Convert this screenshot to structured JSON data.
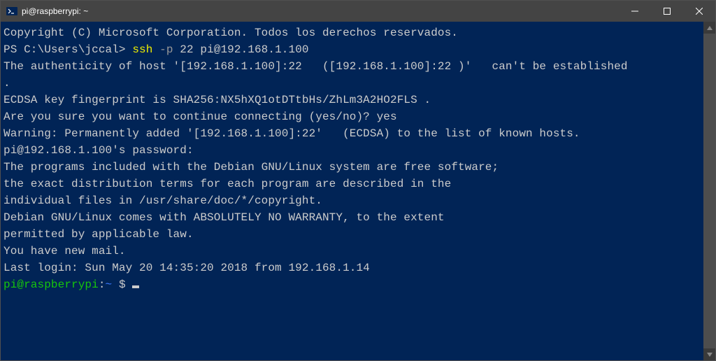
{
  "titlebar": {
    "title": "pi@raspberrypi: ~"
  },
  "terminal": {
    "copyright": "Copyright (C) Microsoft Corporation. Todos los derechos reservados.",
    "blank": "",
    "ps_prompt": "PS C:\\Users\\jccal> ",
    "ssh_cmd": "ssh ",
    "ssh_flag": "-p ",
    "ssh_args": "22 pi@192.168.1.100",
    "auth1": "The authenticity of host '[192.168.1.100]:22   ([192.168.1.100]:22 )'   can't be established",
    "dot": ".",
    "ecdsa": "ECDSA key fingerprint is SHA256:NX5hXQ1otDTtbHs/ZhLm3A2HO2FLS .",
    "confirm": "Are you sure you want to continue connecting (yes/no)? yes",
    "warning": "Warning: Permanently added '[192.168.1.100]:22'   (ECDSA) to the list of known hosts.",
    "password": "pi@192.168.1.100's password:",
    "debian1": "The programs included with the Debian GNU/Linux system are free software;",
    "debian2": "the exact distribution terms for each program are described in the",
    "debian3": "individual files in /usr/share/doc/*/copyright.",
    "warranty1": "Debian GNU/Linux comes with ABSOLUTELY NO WARRANTY, to the extent",
    "warranty2": "permitted by applicable law.",
    "mail": "You have new mail.",
    "lastlogin": "Last login: Sun May 20 14:35:20 2018 from 192.168.1.14",
    "pi_user": "pi@raspberrypi",
    "pi_colon": ":",
    "pi_path": "~ ",
    "pi_dollar": "$ "
  }
}
